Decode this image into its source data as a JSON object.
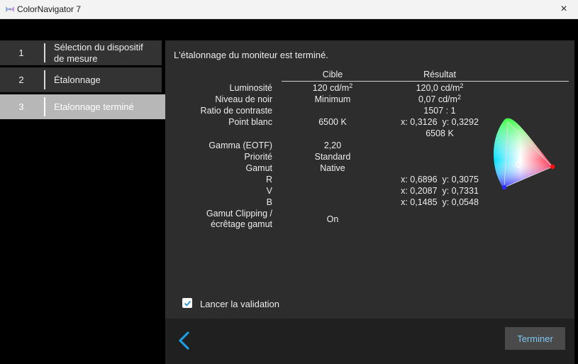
{
  "window": {
    "title": "ColorNavigator 7",
    "close_icon": "×"
  },
  "steps": [
    {
      "num": "1",
      "label": "Sélection du dispositif de mesure"
    },
    {
      "num": "2",
      "label": "Étalonnage"
    },
    {
      "num": "3",
      "label": "Etalonnage terminé"
    }
  ],
  "main": {
    "heading": "L'étalonnage du moniteur est terminé.",
    "col_target": "Cible",
    "col_result": "Résultat",
    "rows": {
      "luminance": {
        "label": "Luminosité",
        "target": "120 cd/m",
        "result": "120,0 cd/m",
        "sup": "2"
      },
      "black": {
        "label": "Niveau de noir",
        "target": "Minimum",
        "result": "0,07 cd/m",
        "sup": "2"
      },
      "contrast": {
        "label": "Ratio de contraste",
        "result": "1507 : 1"
      },
      "white": {
        "label": "Point blanc",
        "target": "6500 K",
        "result": "x: 0,3126  y: 0,3292",
        "result2": "6508 K"
      },
      "gamma": {
        "label": "Gamma (EOTF)",
        "target": "2,20"
      },
      "priority": {
        "label": "Priorité",
        "target": "Standard"
      },
      "gamut": {
        "label": "Gamut",
        "target": "Native"
      },
      "r": {
        "label": "R",
        "result": "x: 0,6896  y: 0,3075"
      },
      "v": {
        "label": "V",
        "result": "x: 0,2087  y: 0,7331"
      },
      "b": {
        "label": "B",
        "result": "x: 0,1485  y: 0,0548"
      },
      "clipping": {
        "label1": "Gamut Clipping /",
        "label2": "écrêtage gamut",
        "target": "On"
      }
    },
    "validation_label": "Lancer la validation",
    "validation_checked": true
  },
  "footer": {
    "finish_label": "Terminer",
    "accent": "#1e9be0"
  }
}
